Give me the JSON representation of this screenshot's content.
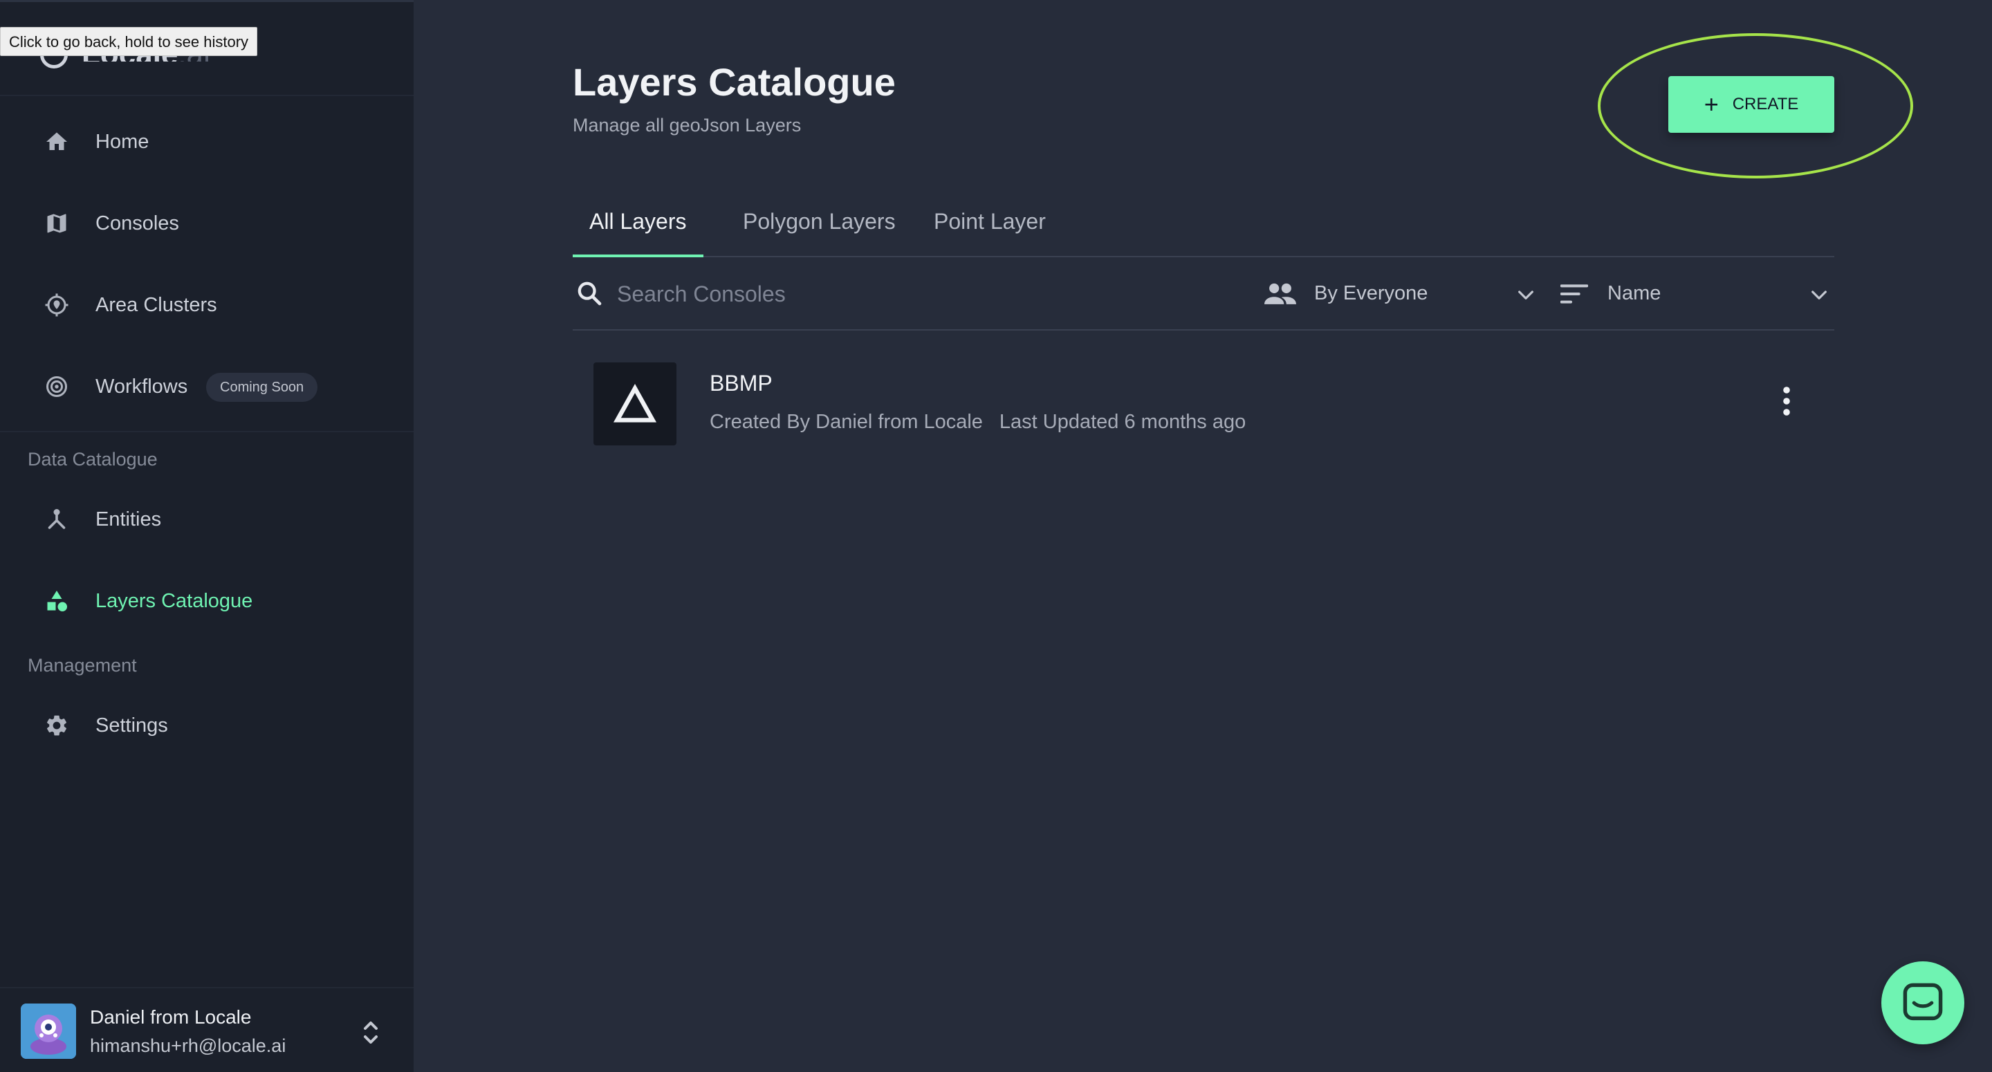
{
  "tooltip": "Click to go back, hold to see history",
  "brand": {
    "name": "Locale",
    "suffix": ".ai"
  },
  "sidebar": {
    "items": [
      {
        "label": "Home",
        "icon": "home-icon"
      },
      {
        "label": "Consoles",
        "icon": "map-icon"
      },
      {
        "label": "Area Clusters",
        "icon": "location-target-icon"
      },
      {
        "label": "Workflows",
        "icon": "workflow-icon",
        "badge": "Coming Soon"
      },
      {
        "label": "Entities",
        "icon": "entities-icon"
      },
      {
        "label": "Layers Catalogue",
        "icon": "layers-shapes-icon",
        "active": true
      },
      {
        "label": "Settings",
        "icon": "gear-icon"
      }
    ],
    "sections": {
      "data_catalogue": "Data Catalogue",
      "management": "Management"
    },
    "user": {
      "name": "Daniel from Locale",
      "email": "himanshu+rh@locale.ai"
    }
  },
  "header": {
    "title": "Layers Catalogue",
    "subtitle": "Manage all geoJson Layers",
    "create_label": "CREATE"
  },
  "tabs": [
    {
      "label": "All Layers",
      "active": true
    },
    {
      "label": "Polygon Layers"
    },
    {
      "label": "Point Layer"
    }
  ],
  "filters": {
    "search_placeholder": "Search Consoles",
    "owner": "By Everyone",
    "sort": "Name"
  },
  "layers": [
    {
      "name": "BBMP",
      "created_by": "Created By Daniel from Locale",
      "updated": "Last Updated 6 months ago"
    }
  ],
  "colors": {
    "accent": "#6ff3b2",
    "background": "#262c3a",
    "sidebar": "#1b202b",
    "highlight_ring": "#a6e44a"
  }
}
